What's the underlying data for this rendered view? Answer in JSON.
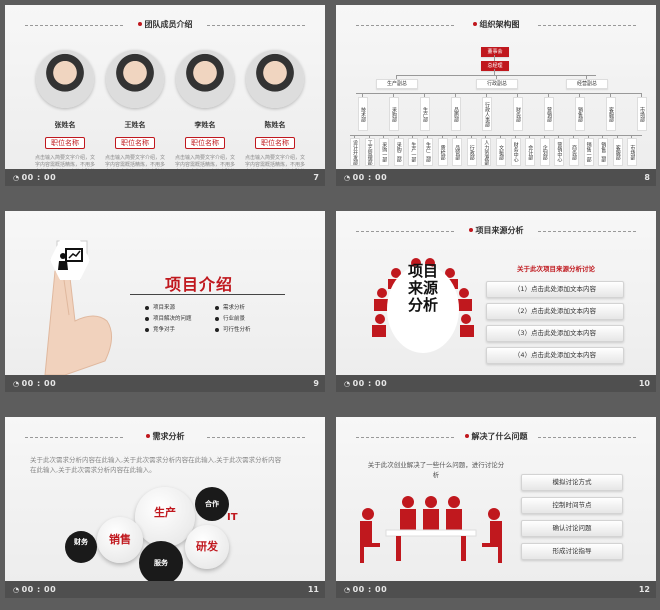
{
  "footer_time": "00 : 00",
  "slide1": {
    "title": "团队成员介绍",
    "page": "7",
    "members": [
      {
        "name": "张姓名",
        "role": "职位名称",
        "desc": "点击输入简要文字介绍，文字内容需概括精炼，不用多余的文字修饰，言简意赅的说明分项内容……"
      },
      {
        "name": "王姓名",
        "role": "职位名称",
        "desc": "点击输入简要文字介绍，文字内容需概括精炼，不用多余的文字修饰，言简意赅的说明分项内容……"
      },
      {
        "name": "李姓名",
        "role": "职位名称",
        "desc": "点击输入简要文字介绍，文字内容需概括精炼，不用多余的文字修饰，言简意赅的说明分项内容……"
      },
      {
        "name": "陈姓名",
        "role": "职位名称",
        "desc": "点击输入简要文字介绍，文字内容需概括精炼，不用多余的文字修饰，言简意赅的说明分项内容……"
      }
    ]
  },
  "slide2": {
    "title": "组织架构图",
    "page": "8",
    "top": "董事会",
    "gm": "总经理",
    "deputies": [
      "生产副总",
      "行政副总",
      "经营副总"
    ],
    "depts": [
      "技术部",
      "采购部",
      "生产部",
      "品质部",
      "行政人事部",
      "财务部",
      "营销部",
      "销售部",
      "客服部",
      "市场部"
    ],
    "units": [
      "设计开发部",
      "工艺管理部",
      "采购一部",
      "采购二部",
      "生产一部",
      "生产二部",
      "质检部",
      "品管部",
      "行政部",
      "人力资源部",
      "文秘部",
      "财务中心",
      "会计部",
      "企划部",
      "营销中心",
      "商务部",
      "销售一部",
      "销售二部",
      "客服部",
      "市场部"
    ]
  },
  "slide3": {
    "title": "项目介绍",
    "page": "9",
    "items": [
      "项目来源",
      "需求分析",
      "项目解决的问题",
      "行业前景",
      "竞争对手",
      "可行性分析"
    ]
  },
  "slide4": {
    "title": "项目来源分析",
    "page": "10",
    "center_text": "项目来源分析",
    "subtitle": "关于此次项目来源分析讨论",
    "options": [
      "（1）点击此处添加文本内容",
      "（2）点击此处添加文本内容",
      "（3）点击此处添加文本内容",
      "（4）点击此处添加文本内容"
    ]
  },
  "slide5": {
    "title": "需求分析",
    "page": "11",
    "text": "关于此次需求分析内容在此输入,关于此次需求分析内容在此输入,关于此次需求分析内容在此输入,关于此次需求分析内容在此输入。",
    "bubbles": {
      "prod": "生产",
      "coop": "合作",
      "it": "IT",
      "sales": "销售",
      "finance": "财务",
      "rd": "研发",
      "service": "服务"
    }
  },
  "slide6": {
    "title": "解决了什么问题",
    "page": "12",
    "text": "关于此次创业解决了一些什么问题，进行讨论分析",
    "buttons": [
      "模拟讨论方式",
      "控制时间节点",
      "确认讨论问题",
      "形成讨论指导"
    ]
  },
  "colors": {
    "accent": "#c0181e",
    "dark": "#1a1a1a"
  }
}
